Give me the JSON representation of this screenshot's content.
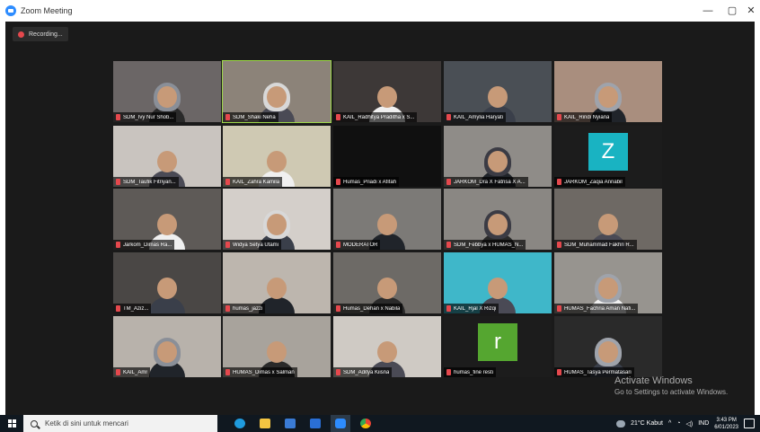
{
  "window": {
    "title": "Zoom Meeting",
    "controls": {
      "minimize": "—",
      "maximize": "▢",
      "close": "✕"
    }
  },
  "meeting": {
    "recording_label": "Recording...",
    "participants": [
      [
        "SDM_Ivy Nur Shob...",
        "SDM_Shaki Neha",
        "KAIL_Radhitya Praditha x S...",
        "KAIL_Amylia Haryati",
        "KAIL_Rindi Nyiana"
      ],
      [
        "SDM_Taufik Fitriyan...",
        "KAIL_Zahra Kamila",
        "Humas_Priadi x Afifah",
        "JARKOM_Dra X Fatrisa X A...",
        "JARKOM_Zaqia Annabil"
      ],
      [
        "Jarkom_Dimas Ra...",
        "Widya Setya Utami",
        "MODERATOR",
        "SDM_Febbya x HUMAS_N...",
        "SDM_Muhammad Fakhri R..."
      ],
      [
        "TM_Aziz...",
        "humas_jazzi",
        "Humas_Dehan x Nabila",
        "KAIL_Rjal X Rizqi",
        "HUMAS_Fachria Aman Nafi..."
      ],
      [
        "KAIL_Amr",
        "HUMAS_Dimas x Salman",
        "SDM_Aditya Kiisna",
        "humas_fine resti",
        "HUMAS_Tasya Permatasari"
      ]
    ],
    "avatars": {
      "r1c4": "Z",
      "r4c3": "r"
    }
  },
  "watermark": {
    "line1": "Activate Windows",
    "line2": "Go to Settings to activate Windows."
  },
  "taskbar": {
    "search_placeholder": "Ketik di sini untuk mencari",
    "apps": [
      "edge-icon",
      "file-explorer-icon",
      "store-icon",
      "mail-icon",
      "zoom-icon",
      "chrome-icon"
    ],
    "weather": "21°C Kabut",
    "language": "IND",
    "time": "3:43 PM",
    "date": "6/01/2023"
  },
  "colors": {
    "active_speaker_border": "#9ed84a",
    "meeting_bg": "#1a1a1a",
    "zoom_blue": "#2d8cff"
  }
}
